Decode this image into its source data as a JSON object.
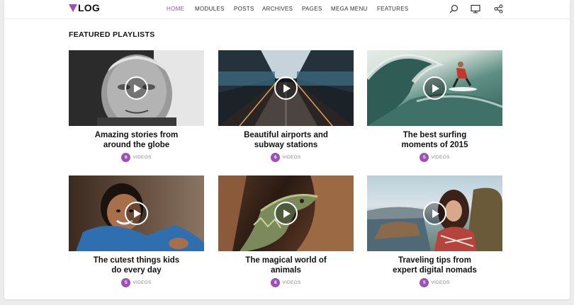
{
  "brand": {
    "logo_text": "LOG",
    "accent": "#9b51b8"
  },
  "nav": {
    "items": [
      {
        "label": "HOME",
        "active": true
      },
      {
        "label": "MODULES",
        "active": false
      },
      {
        "label": "POSTS",
        "active": false
      },
      {
        "label": "ARCHIVES",
        "active": false
      },
      {
        "label": "PAGES",
        "active": false
      },
      {
        "label": "MEGA MENU",
        "active": false
      },
      {
        "label": "FEATURES",
        "active": false
      }
    ],
    "icons": [
      "search-icon",
      "monitor-icon",
      "share-icon"
    ]
  },
  "section": {
    "title": "FEATURED PLAYLISTS"
  },
  "playlists": [
    {
      "title": "Amazing stories from around the globe",
      "count": "6",
      "unit": "VIDEOS",
      "image": "elderly-man-portrait"
    },
    {
      "title": "Beautiful airports and subway stations",
      "count": "6",
      "unit": "VIDEOS",
      "image": "subway-escalator"
    },
    {
      "title": "The best surfing moments of 2015",
      "count": "5",
      "unit": "VIDEOS",
      "image": "surfer-wave"
    },
    {
      "title": "The cutest things kids do every day",
      "count": "5",
      "unit": "VIDEOS",
      "image": "child-portrait"
    },
    {
      "title": "The magical world of animals",
      "count": "8",
      "unit": "VIDEOS",
      "image": "iguana"
    },
    {
      "title": "Traveling tips from expert digital nomads",
      "count": "5",
      "unit": "VIDEOS",
      "image": "woman-coast"
    }
  ]
}
